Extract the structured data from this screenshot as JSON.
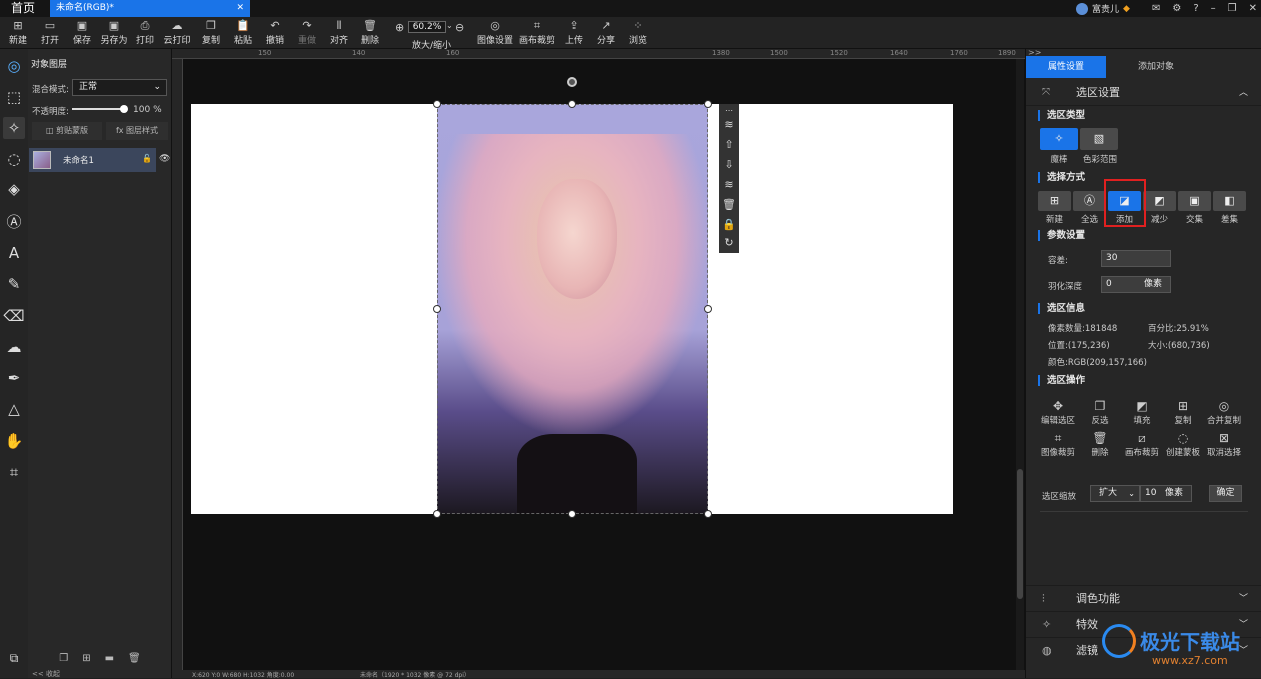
{
  "titlebar": {
    "home": "首页",
    "doc_tab": "未命名(RGB)*",
    "doc_close": "✕",
    "user": "富贵儿"
  },
  "toolbar": {
    "items": [
      {
        "name": "new",
        "label": "新建",
        "icon": "⊞"
      },
      {
        "name": "open",
        "label": "打开",
        "icon": "▭"
      },
      {
        "name": "save",
        "label": "保存",
        "icon": "▣"
      },
      {
        "name": "save-as",
        "label": "另存为",
        "icon": "▣"
      },
      {
        "name": "print",
        "label": "打印",
        "icon": "⎙"
      },
      {
        "name": "cloud-print",
        "label": "云打印",
        "icon": "☁"
      },
      {
        "name": "copy",
        "label": "复制",
        "icon": "❐"
      },
      {
        "name": "paste",
        "label": "粘贴",
        "icon": "📋"
      },
      {
        "name": "undo",
        "label": "撤销",
        "icon": "↶"
      },
      {
        "name": "redo",
        "label": "重做",
        "icon": "↷"
      },
      {
        "name": "align",
        "label": "对齐",
        "icon": "⫴"
      },
      {
        "name": "delete",
        "label": "删除",
        "icon": "🗑"
      }
    ],
    "zoom_value": "60.2%",
    "zoom_label": "放大/缩小",
    "items2": [
      {
        "name": "image-settings",
        "label": "图像设置",
        "icon": "◎"
      },
      {
        "name": "canvas-crop",
        "label": "画布裁剪",
        "icon": "⌗"
      },
      {
        "name": "upload",
        "label": "上传",
        "icon": "⇪"
      },
      {
        "name": "share",
        "label": "分享",
        "icon": "↗"
      },
      {
        "name": "browse",
        "label": "浏览",
        "icon": "⁘"
      }
    ]
  },
  "layers": {
    "title": "对象图层",
    "blend_label": "混合模式:",
    "blend_value": "正常",
    "opacity_label": "不透明度:",
    "opacity_value": "100",
    "opacity_unit": "%",
    "opacity": 1.0,
    "clip_mask": "剪贴蒙版",
    "layer_style": "图层样式",
    "layer_name": "未命名1",
    "collapse": "<< 收起"
  },
  "ruler": {
    "ticks": [
      "150",
      "140",
      "160",
      "1380",
      "1500",
      "1520",
      "1640",
      "1760",
      "1890",
      "1920"
    ]
  },
  "status": {
    "left": "X:620 Y:0 W:680 H:1032 角度:0.00",
    "center": "未命名（1920 * 1032 像素 @ 72 dpi）"
  },
  "rightpanel": {
    "tab_props": "属性设置",
    "tab_add": "添加对象",
    "selection_settings": "选区设置",
    "sel_type": "选区类型",
    "type_magic": "魔棒",
    "type_color": "色彩范围",
    "sel_method": "选择方式",
    "methods": [
      "新建",
      "全选",
      "添加",
      "减少",
      "交集",
      "差集"
    ],
    "params": "参数设置",
    "tolerance_label": "容差:",
    "tolerance": "30",
    "feather_label": "羽化深度",
    "feather": "0",
    "feather_unit": "像素",
    "sel_info": "选区信息",
    "pixel_count": "像素数量:181848",
    "percent": "百分比:25.91%",
    "position": "位置:(175,236)",
    "size": "大小:(680,736)",
    "color": "颜色:RGB(209,157,166)",
    "sel_ops": "选区操作",
    "ops_row1": [
      "编辑选区",
      "反选",
      "填充",
      "复制",
      "合并复制"
    ],
    "ops_row2": [
      "图像裁剪",
      "删除",
      "画布裁剪",
      "创建蒙板",
      "取消选择"
    ],
    "zoom_label": "选区缩放",
    "zoom_mode": "扩大",
    "zoom_value": "10",
    "zoom_unit": "像素",
    "confirm": "确定",
    "fold_color": "调色功能",
    "fold_effects": "特效",
    "fold_more": "滤镜"
  },
  "watermark": {
    "text": "极光下载站",
    "url": "www.xz7.com"
  },
  "colors": {
    "accent": "#1a74e8",
    "highlight": "#e02020"
  }
}
